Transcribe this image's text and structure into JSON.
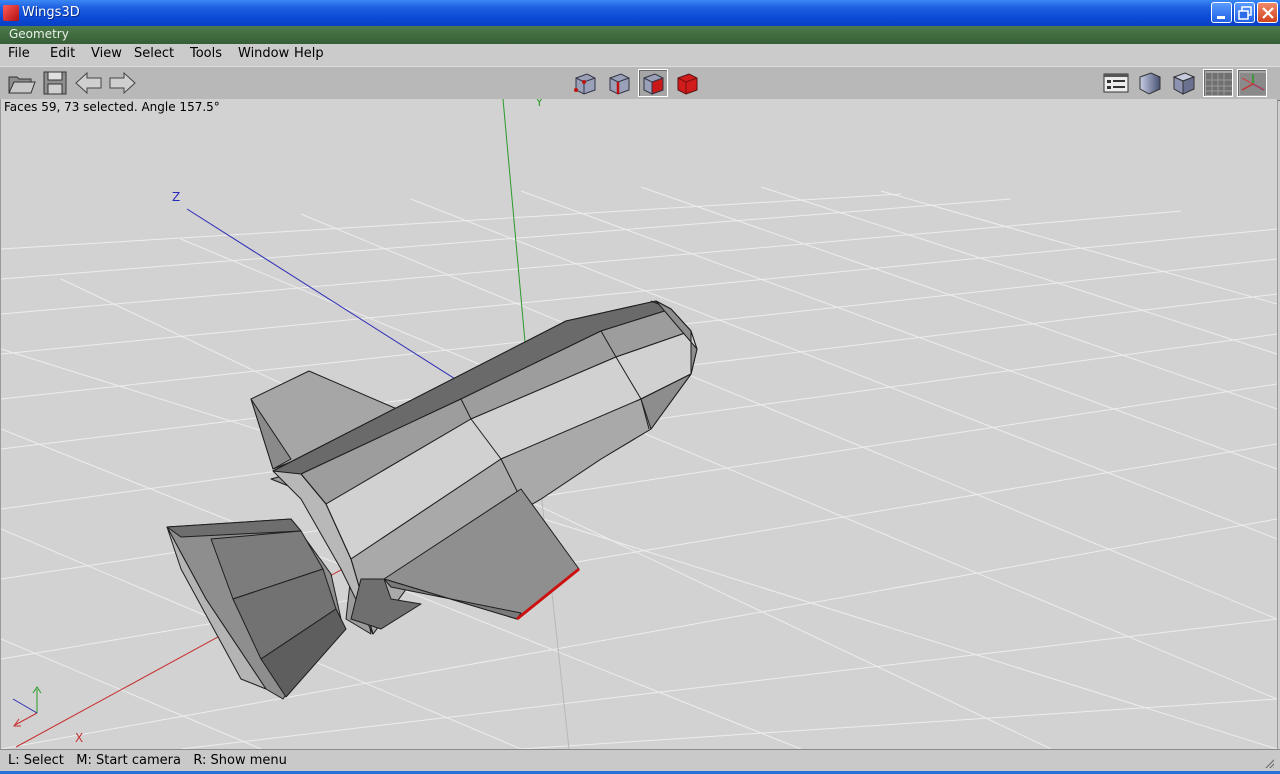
{
  "window": {
    "title": "Wings3D"
  },
  "geometry_header": "Geometry",
  "menu": [
    "File",
    "Edit",
    "View",
    "Select",
    "Tools",
    "Window",
    "Help"
  ],
  "toolbar": {
    "left": [
      "open-folder-icon",
      "save-icon",
      "undo-arrow-icon",
      "redo-arrow-icon"
    ],
    "center": [
      "vertex-select-icon",
      "edge-select-icon",
      "face-select-icon",
      "body-select-icon"
    ],
    "center_active": "face-select-icon",
    "right": [
      "outliner-icon",
      "smooth-shade-icon",
      "flat-shade-icon",
      "groundplane-icon",
      "axes-icon"
    ]
  },
  "viewport": {
    "info": "Faces 59, 73 selected. Angle 157.5°",
    "axis_labels": {
      "x": "X",
      "y": "Y",
      "z": "Z"
    },
    "colors": {
      "x_axis": "#c83030",
      "y_axis": "#2a9a2a",
      "z_axis": "#2a2ab8",
      "selection": "#cc1010"
    }
  },
  "status": "L: Select   M: Start camera   R: Show menu"
}
